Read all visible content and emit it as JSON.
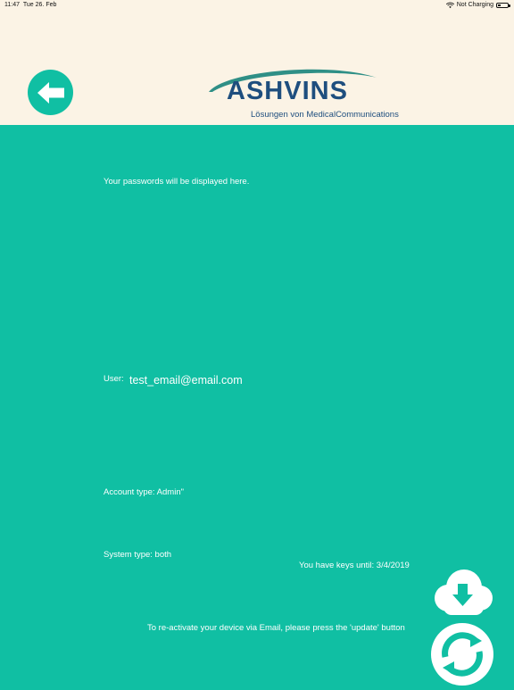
{
  "status_bar": {
    "time": "11:47",
    "date": "Tue 26. Feb",
    "charging": "Not Charging"
  },
  "header": {
    "logo_word": "ASHVINS",
    "logo_tagline": "Lösungen von MedicalCommunications"
  },
  "main": {
    "passwords_info": "Your passwords will be displayed here.",
    "user_label": "User:",
    "user_value": "test_email@email.com",
    "account_type": "Account type: Admin\"",
    "system_type": "System type: both",
    "keys_until": "You have keys until: 3/4/2019",
    "reactivate_info": "To re-activate your device via Email, please press the 'update' button"
  },
  "colors": {
    "teal": "#10BFA3",
    "header_bg": "#FBF3E5",
    "logo_blue": "#1E4E7E"
  },
  "icons": {
    "back": "arrow-left-icon",
    "download": "cloud-download-icon",
    "update": "refresh-icon"
  }
}
